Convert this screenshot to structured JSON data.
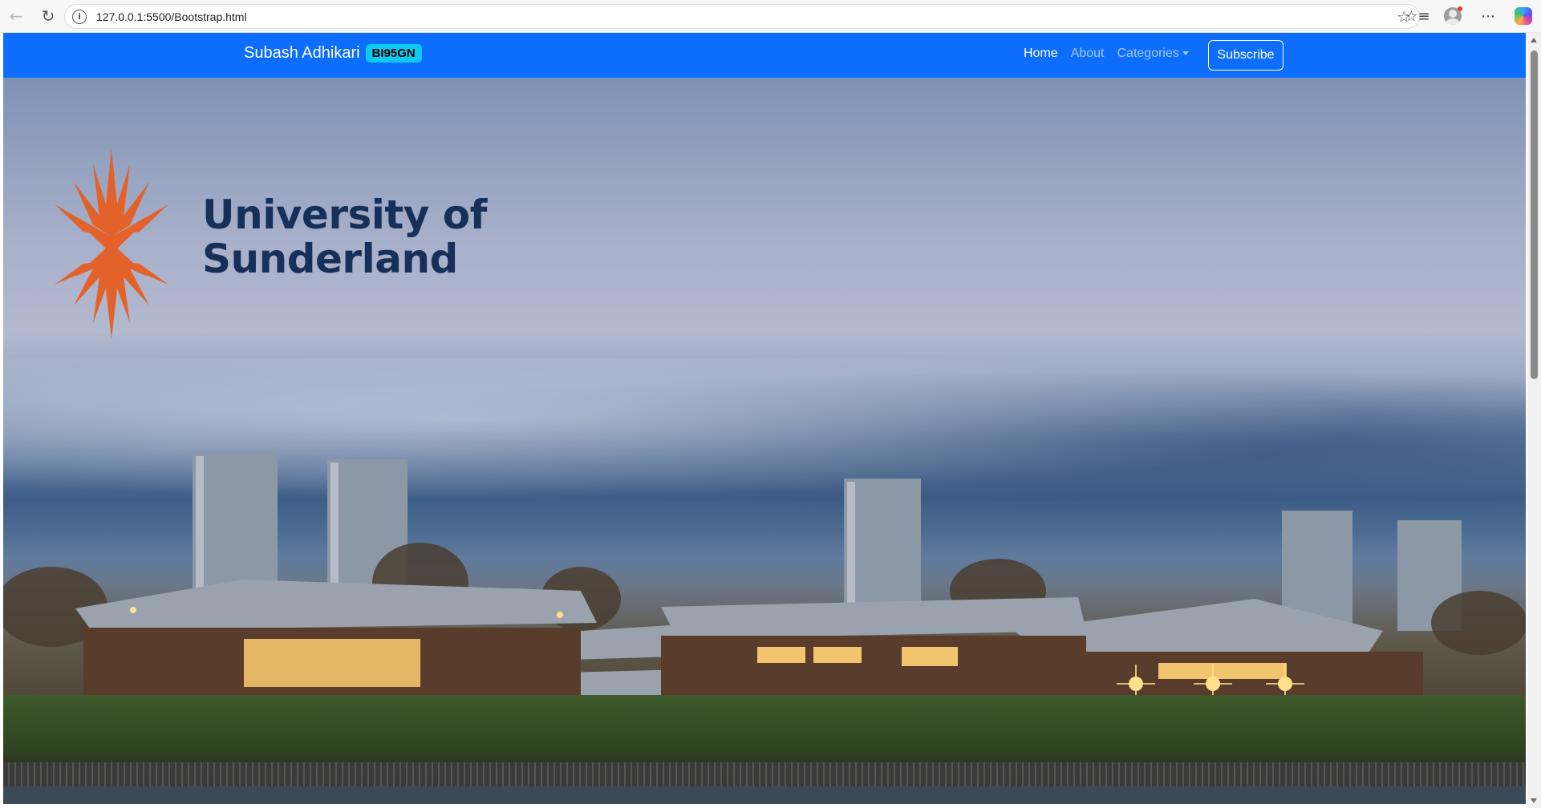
{
  "browser": {
    "url": "127.0.0.1:5500/Bootstrap.html",
    "icons": {
      "back": "back-arrow-icon",
      "reload": "reload-icon",
      "site_info": "info-icon",
      "favorite": "star-icon",
      "favorites": "favorites-icon",
      "profile": "profile-icon",
      "menu": "more-icon",
      "copilot": "copilot-icon"
    }
  },
  "navbar": {
    "brand": "Subash Adhikari",
    "badge": "BI95GN",
    "links": [
      {
        "label": "Home",
        "active": true
      },
      {
        "label": "About",
        "active": false
      },
      {
        "label": "Categories",
        "active": false
      }
    ],
    "subscribe": "Subscribe",
    "bg_color": "#0d6efd",
    "badge_color": "#0dcaf0"
  },
  "hero": {
    "logo_line1": "University of",
    "logo_line2": "Sunderland",
    "logo_color": "#16305a",
    "emblem_color": "#e2622a"
  }
}
